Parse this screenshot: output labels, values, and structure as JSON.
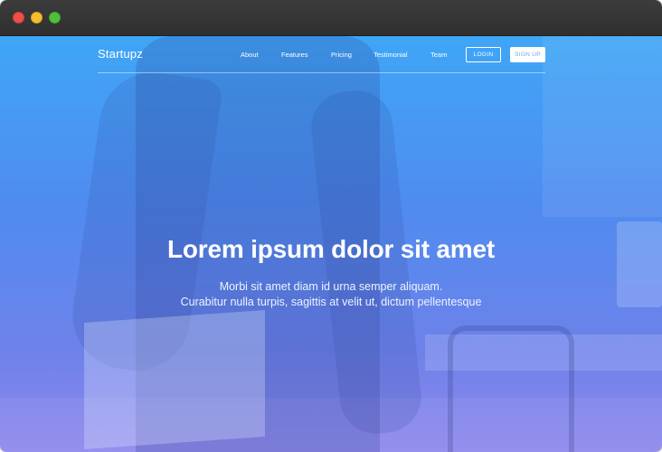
{
  "window": {
    "controls": [
      "close",
      "minimize",
      "maximize"
    ]
  },
  "colors": {
    "gradient_top": "#3fa6f6",
    "gradient_bottom": "#8f88ec",
    "titlebar": "#333333",
    "close": "#ee4f4b",
    "minimize": "#f3be2f",
    "maximize": "#4fbf3a",
    "signup_text": "#6aa6f2"
  },
  "nav": {
    "brand": "Startupz",
    "links": [
      "About",
      "Features",
      "Pricing",
      "Testimonial",
      "Team"
    ],
    "login_label": "LOGIN",
    "signup_label": "SIGN UP"
  },
  "hero": {
    "headline": "Lorem ipsum dolor sit amet",
    "subline_1": "Morbi sit amet diam id urna semper aliquam.",
    "subline_2": "Curabitur nulla turpis, sagittis at velit ut, dictum pellentesque"
  }
}
